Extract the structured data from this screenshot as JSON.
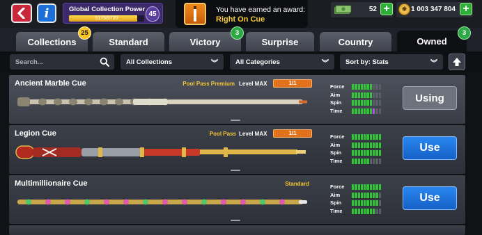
{
  "header": {
    "back_icon": "back-arrow-icon",
    "info_icon": "info-icon",
    "info_label": "i",
    "collection_power": {
      "title": "Global Collection Power",
      "current": "5175",
      "max": "5720",
      "progress_text": "5175/5720",
      "progress": 0.905,
      "level": "45"
    },
    "award": {
      "line1": "You have earned an award:",
      "line2": "Right On Cue",
      "icon": "cue-award-icon"
    },
    "cash": {
      "value": "52",
      "icon": "cash-icon"
    },
    "coins": {
      "value": "1 003 347 804",
      "icon": "coin-icon"
    },
    "plus_label": "+"
  },
  "tabs": [
    {
      "label": "Collections",
      "badge": "25",
      "badge_color": "yellow"
    },
    {
      "label": "Standard"
    },
    {
      "label": "Victory",
      "badge": "3",
      "badge_color": "green"
    },
    {
      "label": "Surprise"
    },
    {
      "label": "Country"
    },
    {
      "label": "Owned",
      "badge": "3",
      "badge_color": "green",
      "active": true
    }
  ],
  "filters": {
    "search_placeholder": "Search...",
    "collections": "All Collections",
    "categories": "All Categories",
    "sort": "Sort by: Stats"
  },
  "stat_labels": [
    "Force",
    "Aim",
    "Spin",
    "Time"
  ],
  "cues": [
    {
      "name": "Ancient Marble Cue",
      "tag": "Pool Pass Premium",
      "level": "Level MAX",
      "progress": "1/1",
      "stats": [
        7,
        7,
        7,
        8
      ],
      "action": "Using",
      "colors": {
        "shaft": "#c9c3b0",
        "accent": "#8a8470",
        "tip": "#d26b2c"
      }
    },
    {
      "name": "Legion Cue",
      "tag": "Pool Pass",
      "level": "Level MAX",
      "progress": "1/1",
      "stats": [
        10,
        10,
        10,
        6
      ],
      "action": "Use",
      "colors": {
        "shaft": "#c9392a",
        "accent": "#e0b84a",
        "tip": "#f0d27a"
      }
    },
    {
      "name": "Multimillionaire Cue",
      "tag": "Standard",
      "level": "",
      "progress": "",
      "stats": [
        10,
        9,
        9,
        8
      ],
      "action": "Use",
      "colors": {
        "shaft": "#c8a64a",
        "accent": "#e05ab0",
        "tip": "#e8e8e8"
      }
    }
  ]
}
